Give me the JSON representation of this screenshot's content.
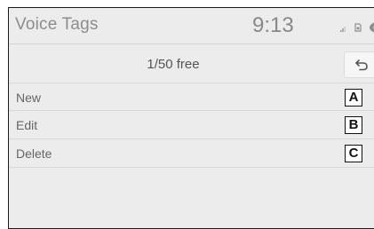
{
  "screen": {
    "title": "Voice Tags",
    "clock": "9:13",
    "count_label": "1/50 free"
  },
  "status_icons": [
    "signal-icon",
    "sim-icon",
    "phone-icon"
  ],
  "back_button": {
    "icon": "back-arrow-icon"
  },
  "menu": {
    "items": [
      {
        "label": "New",
        "callout": "A"
      },
      {
        "label": "Edit",
        "callout": "B"
      },
      {
        "label": "Delete",
        "callout": "C"
      }
    ]
  },
  "colors": {
    "screen_background": "#ececec",
    "divider": "#d8d8d8",
    "text": "#666666",
    "title_text": "#8d8d8d"
  }
}
